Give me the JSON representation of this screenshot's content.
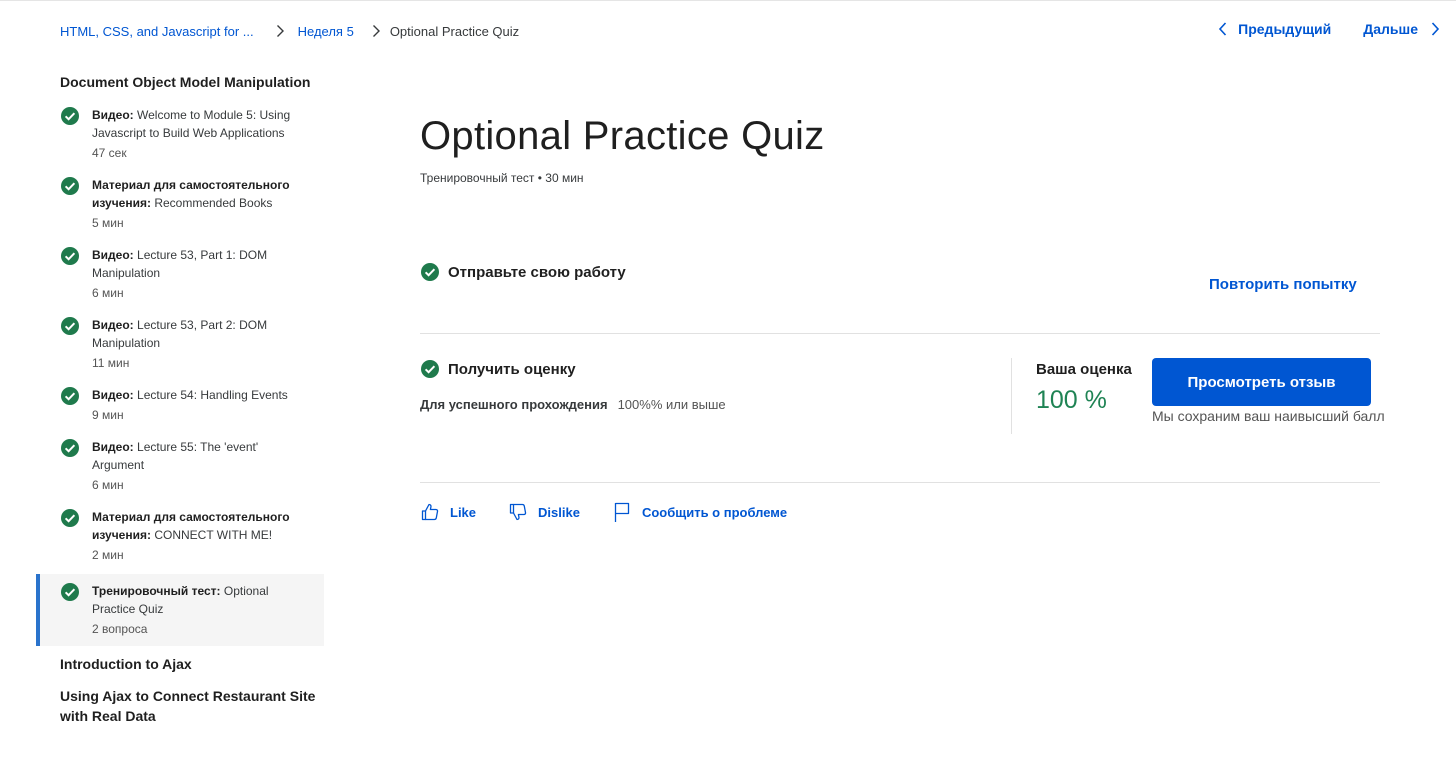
{
  "breadcrumb": {
    "course": "HTML, CSS, and Javascript for ...",
    "week": "Неделя 5",
    "current": "Optional Practice Quiz"
  },
  "nav": {
    "prev_label": "Предыдущий",
    "next_label": "Дальше"
  },
  "sidebar": {
    "module_title": "Document Object Model Manipulation",
    "items": [
      {
        "type": "Видео:",
        "title": "Welcome to Module 5: Using Javascript to Build Web Applications",
        "duration": "47 сек",
        "icon": "check-circle-icon"
      },
      {
        "type": "Материал для самостоятельного изучения:",
        "title": "Recommended Books",
        "duration": "5 мин",
        "icon": "check-circle-icon"
      },
      {
        "type": "Видео:",
        "title": "Lecture 53, Part 1: DOM Manipulation",
        "duration": "6 мин",
        "icon": "check-circle-icon"
      },
      {
        "type": "Видео:",
        "title": "Lecture 53, Part 2: DOM Manipulation",
        "duration": "11 мин",
        "icon": "check-circle-icon"
      },
      {
        "type": "Видео:",
        "title": "Lecture 54: Handling Events",
        "duration": "9 мин",
        "icon": "check-circle-icon"
      },
      {
        "type": "Видео:",
        "title": "Lecture 55: The 'event' Argument",
        "duration": "6 мин",
        "icon": "check-circle-icon"
      },
      {
        "type": "Материал для самостоятельного изучения:",
        "title": "CONNECT WITH ME!",
        "duration": "2 мин",
        "icon": "check-circle-icon"
      },
      {
        "type": "Тренировочный тест:",
        "title": "Optional Practice Quiz",
        "duration": "2 вопроса",
        "icon": "check-circle-icon",
        "selected": true
      }
    ],
    "other_modules": [
      "Introduction to Ajax",
      "Using Ajax to Connect Restaurant Site with Real Data"
    ]
  },
  "main": {
    "title": "Optional Practice Quiz",
    "subtitle": "Тренировочный тест • 30 мин",
    "submit": {
      "label": "Отправьте свою работу",
      "retry_label": "Повторить попытку"
    },
    "grade": {
      "label": "Получить оценку",
      "pass_label": "Для успешного прохождения",
      "pass_value": "100%% или выше",
      "your_grade_label": "Ваша оценка",
      "your_grade_value": "100 %",
      "feedback_button": "Просмотреть отзыв",
      "note": "Мы сохраним ваш наивысший балл"
    },
    "feedback": {
      "like": "Like",
      "dislike": "Dislike",
      "report": "Сообщить о проблеме"
    }
  },
  "colors": {
    "link": "#0056d2",
    "success": "#1f8354",
    "check": "#1f7a4c",
    "selected_bar": "#2a73cc"
  }
}
